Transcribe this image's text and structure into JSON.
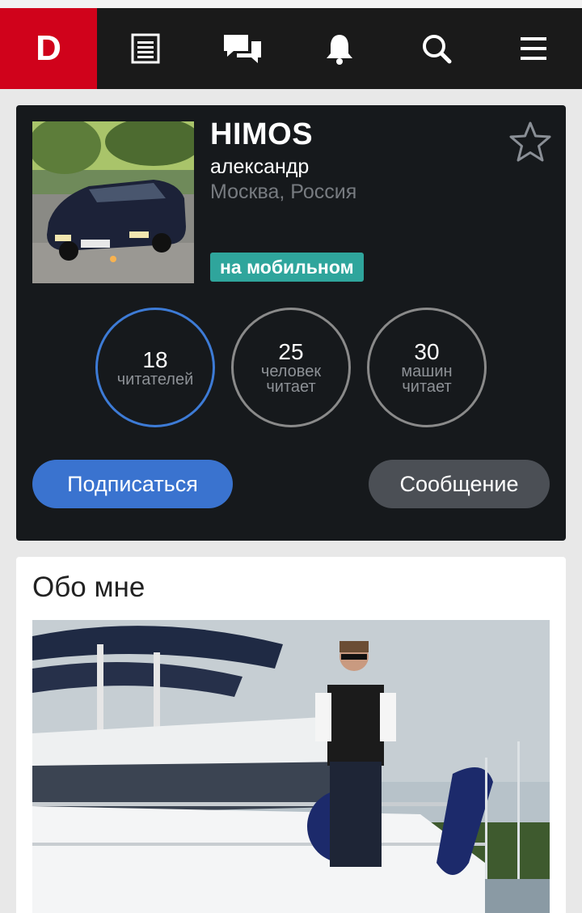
{
  "navbar": {
    "logo": "D",
    "icons": [
      "feed-icon",
      "chat-icon",
      "bell-icon",
      "search-icon",
      "menu-icon"
    ]
  },
  "profile": {
    "username": "HIMOS",
    "real_name": "александр",
    "location": "Москва, Россия",
    "badge": "на мобильном",
    "stats": [
      {
        "value": "18",
        "label": "читателей",
        "label2": ""
      },
      {
        "value": "25",
        "label": "человек",
        "label2": "читает"
      },
      {
        "value": "30",
        "label": "машин",
        "label2": "читает"
      }
    ],
    "subscribe_label": "Подписаться",
    "message_label": "Сообщение"
  },
  "about": {
    "title": "Обо мне"
  },
  "colors": {
    "brand": "#d0021b",
    "accent": "#3a73cf",
    "badge": "#2fa59c",
    "dark_bg": "#16191c"
  }
}
